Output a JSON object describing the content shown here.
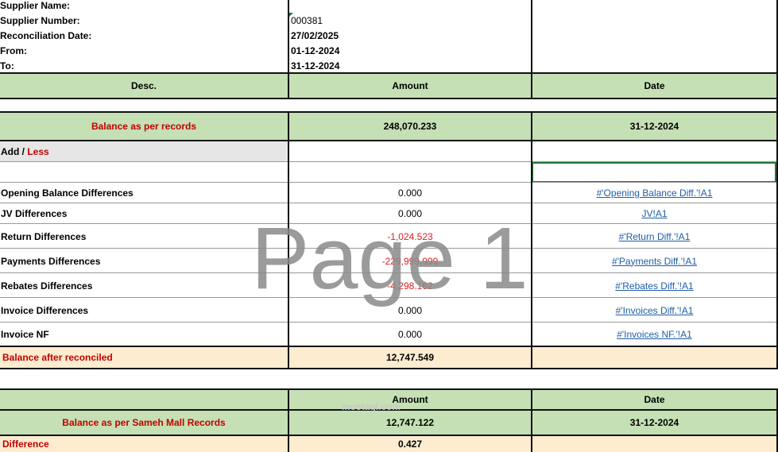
{
  "header": {
    "supplier_name_label": "Supplier Name:",
    "supplier_number_label": "Supplier Number:",
    "supplier_number_value": "000381",
    "reconciliation_date_label": "Reconciliation Date:",
    "reconciliation_date_value": "27/02/2025",
    "from_label": "From:",
    "from_value": "01-12-2024",
    "to_label": "To:",
    "to_value": "31-12-2024"
  },
  "columns": {
    "desc": "Desc.",
    "amount": "Amount",
    "date": "Date"
  },
  "balance_records": {
    "label": "Balance as per  records",
    "amount": "248,070.233",
    "date": "31-12-2024"
  },
  "add_less": {
    "add": "Add",
    "sep": " / ",
    "less": "Less"
  },
  "rows": [
    {
      "label": "Opening Balance Differences",
      "amount": "0.000",
      "link": "#'Opening Balance Diff.'!A1",
      "negative": false
    },
    {
      "label": "JV Differences",
      "amount": "0.000",
      "link": "JV!A1",
      "negative": false
    },
    {
      "label": "Return Differences",
      "amount": "-1,024.523",
      "link": "#'Return Diff.'!A1",
      "negative": true
    },
    {
      "label": "Payments Differences",
      "amount": "-229,999.999",
      "link": "#'Payments Diff.'!A1",
      "negative": true
    },
    {
      "label": "Rebates Differences",
      "amount": "-4,298.162",
      "link": "#'Rebates Diff.'!A1",
      "negative": true
    },
    {
      "label": "Invoice Differences",
      "amount": "0.000",
      "link": "#'Invoices Diff.'!A1",
      "negative": false
    },
    {
      "label": "Invoice NF",
      "amount": "0.000",
      "link": "#'Invoices NF.'!A1",
      "negative": false
    }
  ],
  "balance_after": {
    "label": "Balance after reconciled",
    "amount": "12,747.549"
  },
  "second_table": {
    "amount_header": "Amount",
    "date_header": "Date",
    "mall_label": "Balance as per Sameh Mall Records",
    "mall_amount": "12,747.122",
    "mall_date": "31-12-2024",
    "difference_label": "Difference",
    "difference_amount": "0.427"
  },
  "watermark": "Page 1",
  "logo_text": "mostaql.com"
}
